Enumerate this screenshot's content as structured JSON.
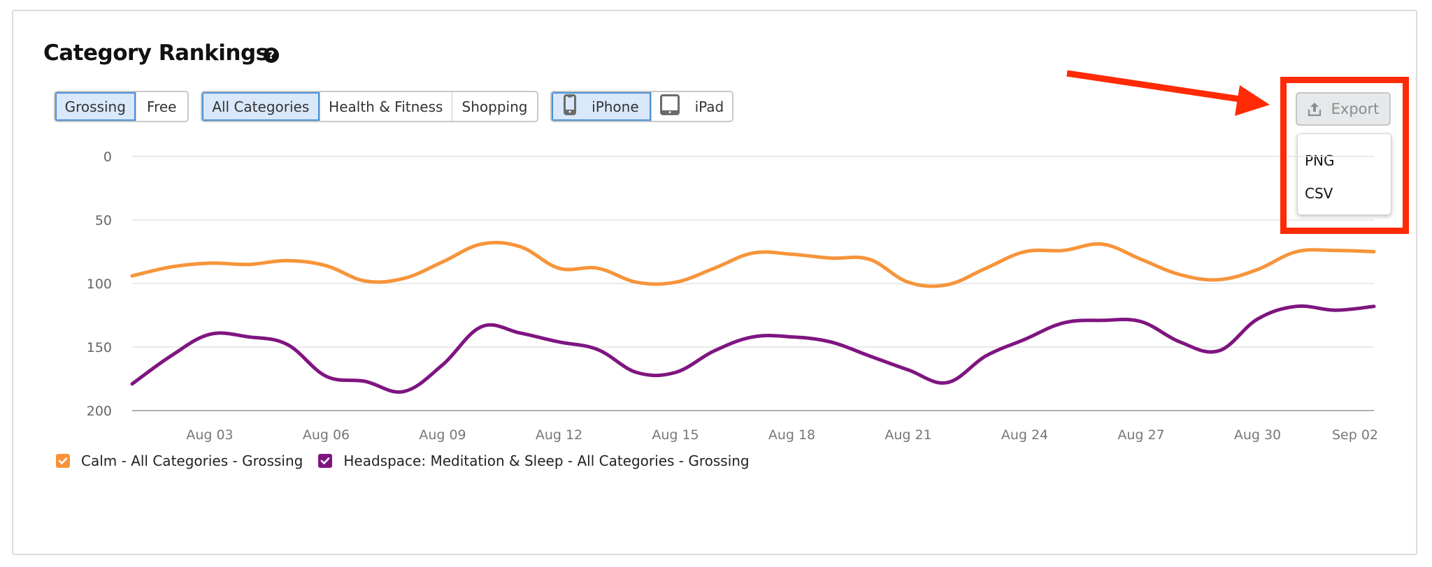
{
  "header": {
    "title": "Category Rankings",
    "help_icon": "question-circle-icon"
  },
  "filters": {
    "chart_type": [
      {
        "label": "Grossing",
        "active": true
      },
      {
        "label": "Free",
        "active": false
      }
    ],
    "category": [
      {
        "label": "All Categories",
        "active": true
      },
      {
        "label": "Health & Fitness",
        "active": false
      },
      {
        "label": "Shopping",
        "active": false
      }
    ],
    "device": [
      {
        "label": "iPhone",
        "icon": "iphone-icon",
        "active": true
      },
      {
        "label": "iPad",
        "icon": "ipad-icon",
        "active": false
      }
    ]
  },
  "export": {
    "label": "Export",
    "icon": "upload-icon",
    "menu": [
      "PNG",
      "CSV"
    ]
  },
  "annotation": {
    "color": "#ff2a06",
    "description": "red arrow and box highlighting Export menu"
  },
  "chart_data": {
    "type": "line",
    "title": "Category Rankings",
    "xlabel": "",
    "ylabel": "",
    "y_inverted": true,
    "ylim": [
      0,
      200
    ],
    "yticks": [
      0,
      50,
      100,
      150,
      200
    ],
    "x": [
      "Aug 01",
      "Aug 02",
      "Aug 03",
      "Aug 04",
      "Aug 05",
      "Aug 06",
      "Aug 07",
      "Aug 08",
      "Aug 09",
      "Aug 10",
      "Aug 11",
      "Aug 12",
      "Aug 13",
      "Aug 14",
      "Aug 15",
      "Aug 16",
      "Aug 17",
      "Aug 18",
      "Aug 19",
      "Aug 20",
      "Aug 21",
      "Aug 22",
      "Aug 23",
      "Aug 24",
      "Aug 25",
      "Aug 26",
      "Aug 27",
      "Aug 28",
      "Aug 29",
      "Aug 30",
      "Aug 31",
      "Sep 01",
      "Sep 02"
    ],
    "xtick_labels": [
      "Aug 03",
      "Aug 06",
      "Aug 09",
      "Aug 12",
      "Aug 15",
      "Aug 18",
      "Aug 21",
      "Aug 24",
      "Aug 27",
      "Aug 30",
      "Sep 02"
    ],
    "grid": true,
    "legend_position": "bottom-left",
    "series": [
      {
        "name": "Calm - All Categories - Grossing",
        "color": "#f7943a",
        "checked": true,
        "values": [
          94,
          87,
          84,
          85,
          82,
          86,
          98,
          96,
          83,
          69,
          71,
          88,
          88,
          99,
          99,
          88,
          76,
          77,
          80,
          81,
          99,
          101,
          88,
          75,
          74,
          69,
          81,
          93,
          97,
          89,
          75,
          74,
          75
        ]
      },
      {
        "name": "Headspace: Meditation & Sleep - All Categories - Grossing",
        "color": "#7f1580",
        "checked": true,
        "values": [
          179,
          157,
          140,
          142,
          148,
          173,
          177,
          185,
          164,
          134,
          139,
          146,
          152,
          170,
          170,
          153,
          142,
          142,
          146,
          157,
          168,
          178,
          157,
          144,
          131,
          129,
          130,
          146,
          153,
          128,
          118,
          121,
          118
        ]
      }
    ]
  }
}
